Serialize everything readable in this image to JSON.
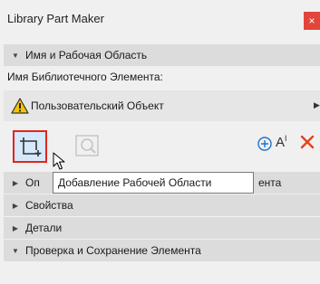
{
  "window": {
    "title": "Library Part Maker",
    "close_label": "×"
  },
  "sections": {
    "name_workspace": "Имя и Рабочая Область",
    "options_partial": "Оп",
    "options_tail": "ента",
    "properties": "Свойства",
    "details": "Детали",
    "check_save": "Проверка и Сохранение Элемента"
  },
  "name_field": {
    "label": "Имя Библиотечного Элемента:",
    "value": "Пользовательский Объект"
  },
  "toolbar": {
    "text_tool_label": "A",
    "text_tool_sup": "I"
  },
  "tooltip": {
    "text": "Добавление Рабочей Области"
  },
  "colors": {
    "accent_red": "#e3231b",
    "selected_bg": "#d6e8fb",
    "section_bg": "#dcdcdc",
    "panel_bg": "#f0f0f0",
    "plus_blue": "#1e73c8",
    "delete_red": "#e8401c"
  },
  "icons": {
    "close": "close-icon",
    "warning": "warning-icon",
    "add_workspace": "add-workspace-icon",
    "zoom": "zoom-icon",
    "plus_circle": "plus-circle-icon",
    "text": "text-icon",
    "delete": "delete-icon",
    "expanded": "chevron-down-icon",
    "collapsed": "chevron-right-icon"
  }
}
